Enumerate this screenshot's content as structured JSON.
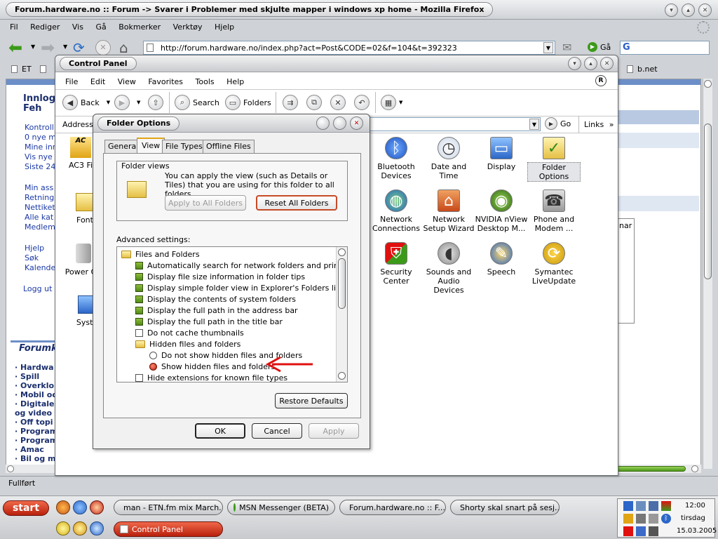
{
  "firefox": {
    "title": "Forum.hardware.no :: Forum -> Svarer i Problemer med skjulte mapper i windows xp home - Mozilla Firefox",
    "menu": [
      "Fil",
      "Rediger",
      "Vis",
      "Gå",
      "Bokmerker",
      "Verktøy",
      "Hjelp"
    ],
    "url": "http://forum.hardware.no/index.php?act=Post&CODE=02&f=104&t=392323",
    "go_label": "Gå",
    "bookmark1": "ET",
    "bookmark_right": "b.net",
    "status": "Fullført"
  },
  "forum_sidebar": {
    "login_title": "Innlog",
    "login_sub": "Feh",
    "links1": [
      "Kontroll",
      "0 nye m",
      "Mine inr",
      "Vis nye",
      "Siste 24"
    ],
    "links2": [
      "Min ass",
      "Retning",
      "Nettiket",
      "Alle kat",
      "Medlem"
    ],
    "links3": [
      "Hjelp",
      "Søk",
      "Kalende"
    ],
    "logout": "Logg ut",
    "forum_heading": "Forumk",
    "cats": [
      "Hardwa",
      "Spill",
      "Overklo",
      "Mobil oc",
      "Digitale",
      "og video",
      "Off topi",
      "Program",
      "Program",
      "Amac",
      "Bil og m"
    ],
    "right_fragment": "nar"
  },
  "control_panel": {
    "title": "Control Panel",
    "menu": [
      "File",
      "Edit",
      "View",
      "Favorites",
      "Tools",
      "Help"
    ],
    "back": "Back",
    "search": "Search",
    "folders": "Folders",
    "address_label": "Address",
    "go": "Go",
    "links": "Links",
    "left_items": [
      "AC3 Fi",
      "Font",
      "Power Op",
      "Syste"
    ],
    "items": [
      {
        "label": "Bluetooth Devices",
        "icon": "bluetooth-icon"
      },
      {
        "label": "Date and Time",
        "icon": "clock-icon"
      },
      {
        "label": "Display",
        "icon": "display-icon"
      },
      {
        "label": "Folder Options",
        "icon": "folder-options-icon"
      },
      {
        "label": "Network Connections",
        "icon": "network-icon"
      },
      {
        "label": "Network Setup Wizard",
        "icon": "network-wizard-icon"
      },
      {
        "label": "NVIDIA nView Desktop M...",
        "icon": "nvidia-icon"
      },
      {
        "label": "Phone and Modem ...",
        "icon": "phone-icon"
      },
      {
        "label": "Security Center",
        "icon": "shield-icon"
      },
      {
        "label": "Sounds and Audio Devices",
        "icon": "speaker-icon"
      },
      {
        "label": "Speech",
        "icon": "speech-icon"
      },
      {
        "label": "Symantec LiveUpdate",
        "icon": "liveupdate-icon"
      }
    ]
  },
  "folder_options": {
    "title": "Folder Options",
    "tabs": [
      "General",
      "View",
      "File Types",
      "Offline Files"
    ],
    "active_tab": "View",
    "folder_views_legend": "Folder views",
    "folder_views_text": "You can apply the view (such as Details or Tiles) that you are using for this folder to all folders.",
    "apply_all": "Apply to All Folders",
    "reset_all": "Reset All Folders",
    "advanced_label": "Advanced settings:",
    "settings": [
      {
        "text": "Files and Folders",
        "kind": "folder",
        "indent": 0
      },
      {
        "text": "Automatically search for network folders and printers",
        "kind": "check-on",
        "indent": 1
      },
      {
        "text": "Display file size information in folder tips",
        "kind": "check-on",
        "indent": 1
      },
      {
        "text": "Display simple folder view in Explorer's Folders list",
        "kind": "check-on",
        "indent": 1
      },
      {
        "text": "Display the contents of system folders",
        "kind": "check-on",
        "indent": 1
      },
      {
        "text": "Display the full path in the address bar",
        "kind": "check-on",
        "indent": 1
      },
      {
        "text": "Display the full path in the title bar",
        "kind": "check-on",
        "indent": 1
      },
      {
        "text": "Do not cache thumbnails",
        "kind": "check-off",
        "indent": 1
      },
      {
        "text": "Hidden files and folders",
        "kind": "folder",
        "indent": 1
      },
      {
        "text": "Do not show hidden files and folders",
        "kind": "radio-off",
        "indent": 2
      },
      {
        "text": "Show hidden files and folders",
        "kind": "radio-on",
        "indent": 2
      },
      {
        "text": "Hide extensions for known file types",
        "kind": "check-off",
        "indent": 1
      }
    ],
    "restore_defaults": "Restore Defaults",
    "ok": "OK",
    "cancel": "Cancel",
    "apply": "Apply"
  },
  "taskbar": {
    "start": "start",
    "tasks": [
      "man - ETN.fm mix March...",
      "MSN Messenger (BETA)",
      "Forum.hardware.no :: F...",
      "Shorty skal snart på sesj..."
    ],
    "active_task": "Control Panel",
    "time": "12:00",
    "day": "tirsdag",
    "date": "15.03.2005"
  },
  "colors": {
    "arrow": "#e01010",
    "start_red": "#d22a12",
    "link_blue": "#1a39a6",
    "check_green": "#5a9a1e"
  }
}
